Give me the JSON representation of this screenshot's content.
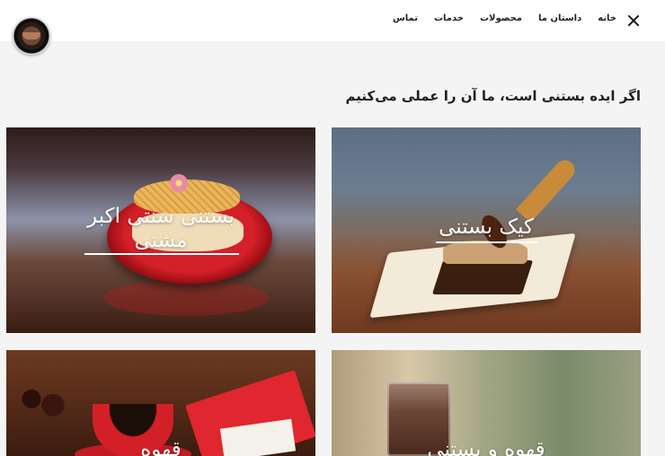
{
  "header": {
    "nav": [
      {
        "label": "تماس"
      },
      {
        "label": "خدمات"
      },
      {
        "label": "محصولات"
      },
      {
        "label": "داستان ما"
      },
      {
        "label": "خانه"
      }
    ]
  },
  "main": {
    "headline": "اگر ایده بستنی است، ما آن را عملی می‌کنیم",
    "cards": [
      {
        "title": "کیک بستنی"
      },
      {
        "title_line1": "بستنی سنتی اکبر",
        "title_line2": "مشتی"
      },
      {
        "title": "قهوه و بستنی"
      },
      {
        "title": "قهوه"
      }
    ]
  }
}
